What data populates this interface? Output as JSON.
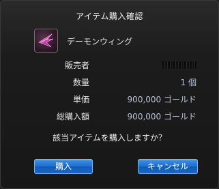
{
  "dialog": {
    "title": "アイテム購入確認",
    "item": {
      "name": "デーモンウィング",
      "icon": "demon-wing-icon"
    },
    "rows": [
      {
        "label": "販売者",
        "value": ""
      },
      {
        "label": "数量",
        "value": "1 個"
      },
      {
        "label": "単価",
        "value": "900,000 ゴールド"
      },
      {
        "label": "総購入額",
        "value": "900,000 ゴールド"
      }
    ],
    "question": "該当アイテムを購入しますか？",
    "buttons": {
      "buy": "購入",
      "cancel": "キャンセル"
    }
  },
  "colors": {
    "value_text": "#b7c2d7",
    "button_blue": "#1f6fd0",
    "background": "#1c1c1c"
  }
}
